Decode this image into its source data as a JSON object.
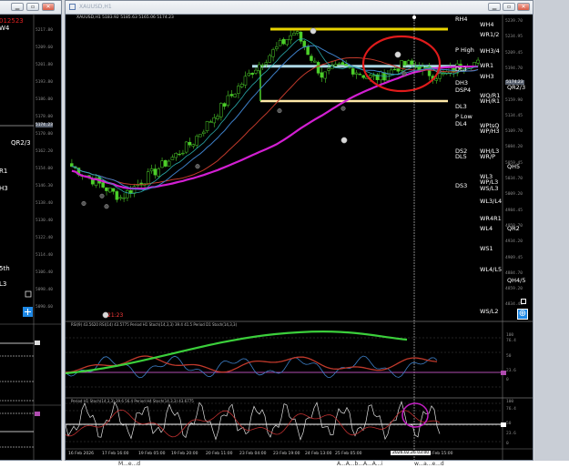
{
  "main_window": {
    "title": "XAUUSD,H1",
    "info": "XAUUSD,H1  5183.92 5185.63 5165.06 5174.23"
  },
  "left_window": {
    "labels": [
      "012523",
      "W4",
      "QR2/3",
      "R1",
      "H3",
      "5th",
      "L3"
    ],
    "price_ticks": [
      "5217.80",
      "5209.60",
      "5201.80",
      "5193.80",
      "5186.00",
      "5178.00",
      "5170.00",
      "5162.20",
      "5154.00",
      "5146.30",
      "5138.40",
      "5130.40",
      "5122.40",
      "5114.40",
      "5106.40",
      "5098.40",
      "5090.60"
    ],
    "price_tag": "5174.23"
  },
  "pivot_labels": [
    {
      "text": "RH4",
      "color": "#ffffff"
    },
    {
      "text": "WH4",
      "color": "#ffffff"
    },
    {
      "text": "WR1/2",
      "color": "#ffffff"
    },
    {
      "text": "P High",
      "color": "#ffffff"
    },
    {
      "text": "WH3/4",
      "color": "#ffffff"
    },
    {
      "text": "WR1",
      "color": "#ffffff"
    },
    {
      "text": "DL3",
      "color": "#ffffff"
    },
    {
      "text": "WH3",
      "color": "#ffffff"
    },
    {
      "text": "DH3",
      "color": "#ffffff"
    },
    {
      "text": "QR2/3",
      "color": "#ffffff"
    },
    {
      "text": "DSP4",
      "color": "#ffffff"
    },
    {
      "text": "WQ/R1",
      "color": "#ffffff"
    },
    {
      "text": "WH/R1",
      "color": "#ffffff"
    },
    {
      "text": "DL3",
      "color": "#ffffff"
    },
    {
      "text": "P Low",
      "color": "#ffffff"
    },
    {
      "text": "DL4",
      "color": "#ffffff"
    },
    {
      "text": "WPtsQ",
      "color": "#ffffff"
    },
    {
      "text": "WP/H3",
      "color": "#ffffff"
    },
    {
      "text": "DS2",
      "color": "#ffffff"
    },
    {
      "text": "DL5",
      "color": "#ffffff"
    },
    {
      "text": "WH/L3",
      "color": "#ffffff"
    },
    {
      "text": "WR/P",
      "color": "#ffffff"
    },
    {
      "text": "QH5",
      "color": "#ffffff"
    },
    {
      "text": "WL3",
      "color": "#ffffff"
    },
    {
      "text": "WP/L3",
      "color": "#ffffff"
    },
    {
      "text": "DS3",
      "color": "#ffffff"
    },
    {
      "text": "WS/L3",
      "color": "#ffffff"
    },
    {
      "text": "WL3/L4",
      "color": "#ffffff"
    },
    {
      "text": "WR4R1",
      "color": "#ffffff"
    },
    {
      "text": "WL4",
      "color": "#ffffff"
    },
    {
      "text": "QR2",
      "color": "#ffffff"
    },
    {
      "text": "WS1",
      "color": "#ffffff"
    },
    {
      "text": "WL4/L5",
      "color": "#ffffff"
    },
    {
      "text": "QH4/5",
      "color": "#ffffff"
    },
    {
      "text": "WS/L2",
      "color": "#ffffff"
    }
  ],
  "price_ticks": [
    "5239.70",
    "5234.95",
    "5209.45",
    "5194.70",
    "5184.45",
    "5159.90",
    "5134.45",
    "5109.70",
    "5084.20",
    "5059.45",
    "5034.70",
    "5009.20",
    "4984.45",
    "4959.70",
    "4934.20",
    "4909.45",
    "4884.70",
    "4859.20",
    "4834.45"
  ],
  "current_price_tag": "5174.23",
  "countdown": "21:23",
  "rsi_title": "RSI(9) 43.5620  RSI(14) 43.5775  Period H1 Stoch(14,3,3) 39.4 41.5  Period D1 Stoch(14,3,3)",
  "rsi_ticks": [
    "100",
    "76.4",
    "50",
    "23.6",
    "0"
  ],
  "stoch_title": "Period H1 Stoch(14,3,3) 39.6 56.4 Period H4 Stoch(14,3,3) 43.6775",
  "stoch_ticks": [
    "100",
    "76.4",
    "50",
    "23.6",
    "0"
  ],
  "time_axis": [
    "16 Feb 2026",
    "17 Feb 16:00",
    "19 Feb 05:00",
    "19 Feb 20:00",
    "20 Feb 11:00",
    "23 Feb 04:00",
    "23 Feb 19:00",
    "24 Feb 13:00",
    "25 Feb 05:00",
    "26 Feb 15:00"
  ],
  "crosshair_time": "2026.02.26 03:00",
  "colors": {
    "yellow_line": "#e8d400",
    "light_blue_line": "#add8e6",
    "cream_line": "#ffe9a8",
    "ma_magenta": "#d21fd2",
    "ma_red": "#c0392b",
    "ma_blue": "#3d7fc7",
    "ma_cyan": "#2aa9a9",
    "candle": "#4ccf2a",
    "circle": "#e01b1b",
    "stoch_circle": "#c21ec2"
  },
  "taskbar": [
    "M...e...d",
    "A...A...b...A...A...i",
    "w...a...e...d"
  ]
}
